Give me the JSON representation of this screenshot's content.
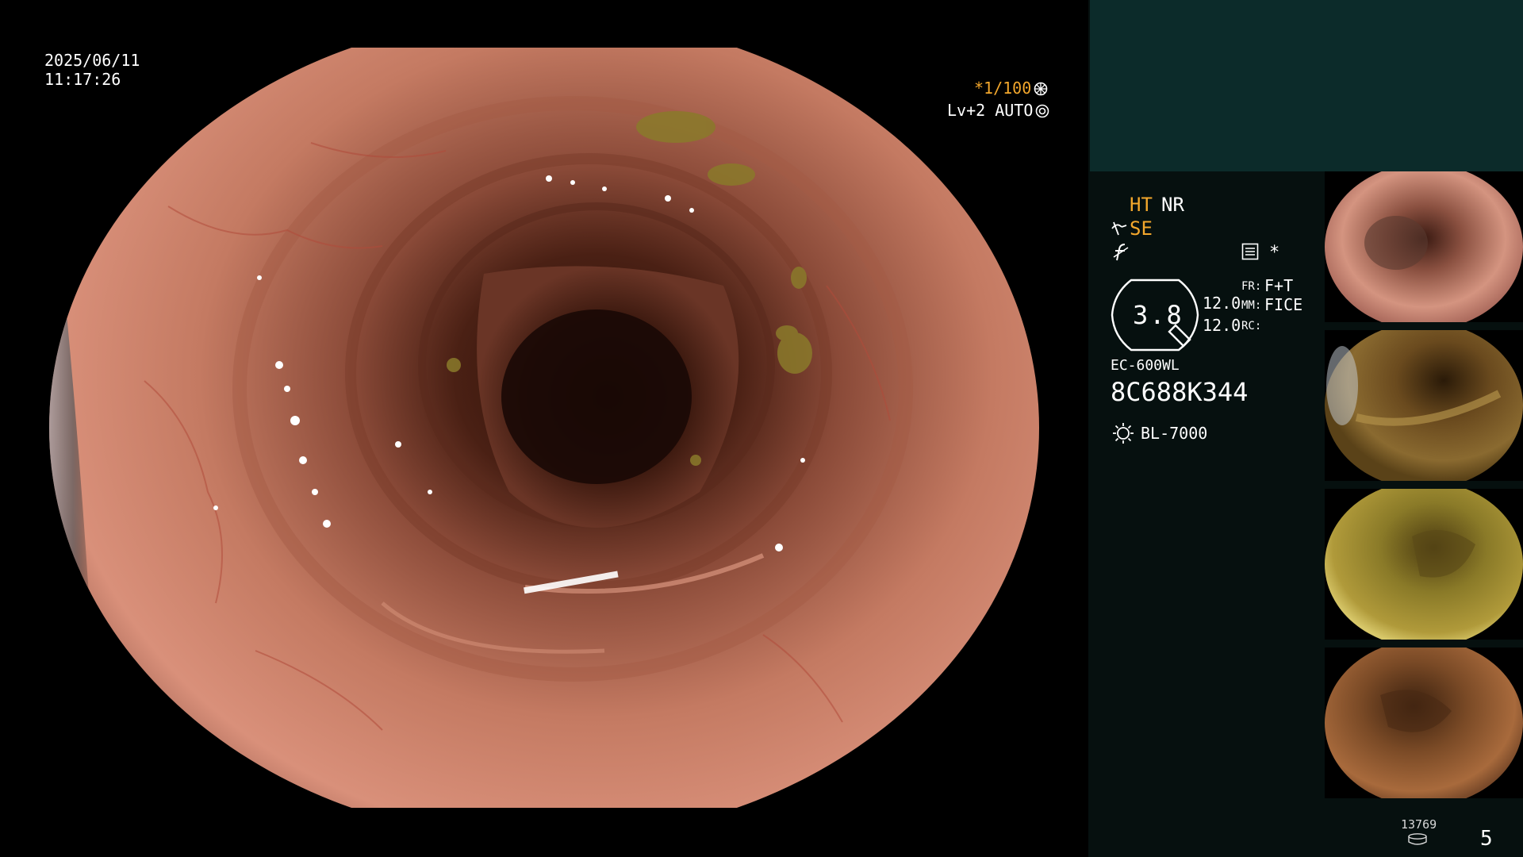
{
  "osd": {
    "date": "2025/06/11",
    "time": "11:17:26",
    "shutter_prefix": "*",
    "shutter": "1/100",
    "level": "Lv+2 AUTO"
  },
  "panel": {
    "ht": "HT",
    "nr": "NR",
    "se": "SE",
    "star": "*",
    "zoom": "3.8",
    "value_1": "12.0",
    "value_2": "12.0",
    "fr_label": "FR:",
    "fr_value": "F+T",
    "mm_label": "MM:",
    "mm_value": "FICE",
    "rc_label": "RC:",
    "scope_model": "EC-600WL",
    "scope_serial": "8C688K344",
    "light_source": "BL-7000",
    "image_count": "13769",
    "page_number": "5"
  },
  "thumbnails": [
    {
      "name": "thumbnail-1",
      "tone": "pink"
    },
    {
      "name": "thumbnail-2",
      "tone": "olive"
    },
    {
      "name": "thumbnail-3",
      "tone": "yellow"
    },
    {
      "name": "thumbnail-4",
      "tone": "brown"
    }
  ],
  "colors": {
    "accent": "#f3a72c",
    "panel_top": "#0c2b2a",
    "panel_bg": "#06100f"
  },
  "icons": [
    "shutter-icon",
    "auto-icon",
    "se-icon",
    "f-icon",
    "menu-icon",
    "zoom-frame-icon",
    "light-source-icon",
    "storage-icon"
  ]
}
